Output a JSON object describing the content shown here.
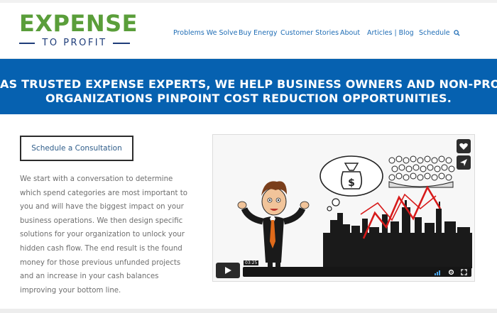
{
  "logo": {
    "name": "EXPENSE",
    "tagline": "TO PROFIT"
  },
  "nav": {
    "items": [
      "Problems We Solve",
      "Buy Energy",
      "Customer Stories",
      "About",
      "Articles | Blog",
      "Schedule"
    ],
    "search_icon": "search-icon"
  },
  "banner": {
    "line1": "AS TRUSTED EXPENSE EXPERTS, WE HELP BUSINESS OWNERS AND NON-PROFIT",
    "line2": "ORGANIZATIONS PINPOINT COST REDUCTION OPPORTUNITIES."
  },
  "cta": {
    "label": "Schedule a Consultation"
  },
  "body": {
    "lines": [
      "We start with a conversation to determine",
      "which spend categories are most important to",
      "you and will have the biggest impact on your",
      "business operations. We then design specific",
      "solutions for your organization to unlock your",
      "hidden cash flow. The end result is the found",
      "money for those previous unfunded projects",
      "and an increase in your cash balances",
      "improving your bottom line."
    ]
  },
  "video": {
    "time": "03:25",
    "buttons": [
      "heart-icon",
      "share-icon"
    ],
    "controls": [
      "play-icon",
      "volume-icon",
      "settings-icon",
      "fullscreen-icon"
    ]
  },
  "colors": {
    "logo_green": "#5a9e3a",
    "logo_navy": "#1f3d7a",
    "nav_blue": "#1f6db5",
    "banner_blue": "#0661b0",
    "body_text": "#6e6e6e"
  }
}
